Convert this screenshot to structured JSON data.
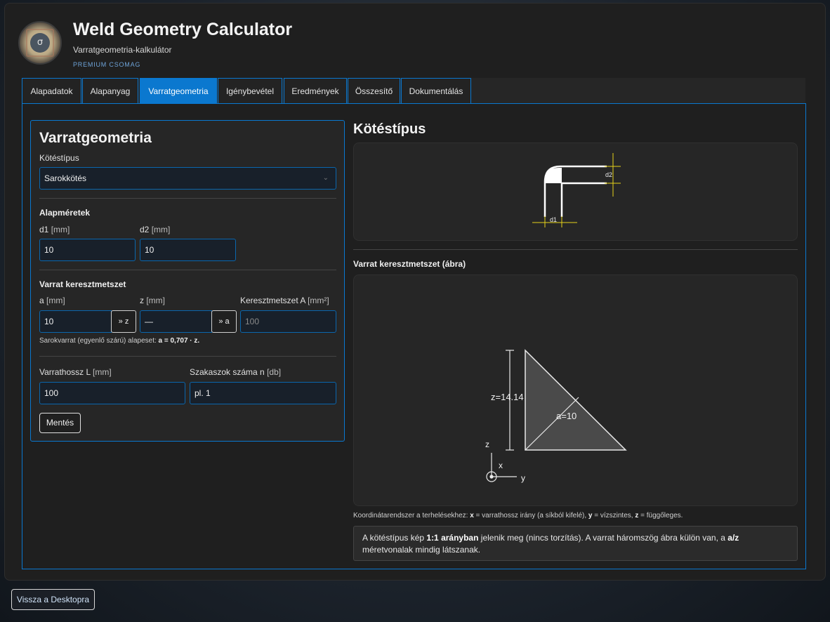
{
  "app": {
    "title": "Weld Geometry Calculator",
    "subtitle": "Varratgeometria-kalkulátor",
    "badge": "PREMIUM CSOMAG",
    "logo_glyph": "σ"
  },
  "tabs": [
    {
      "label": "Alapadatok",
      "active": false
    },
    {
      "label": "Alapanyag",
      "active": false
    },
    {
      "label": "Varratgeometria",
      "active": true
    },
    {
      "label": "Igénybevétel",
      "active": false
    },
    {
      "label": "Eredmények",
      "active": false
    },
    {
      "label": "Összesítő",
      "active": false
    },
    {
      "label": "Dokumentálás",
      "active": false
    }
  ],
  "form": {
    "title": "Varratgeometria",
    "joint_type_label": "Kötéstípus",
    "joint_type_value": "Sarokkötés",
    "base_dims_title": "Alapméretek",
    "d1_label": "d1",
    "d1_unit": "[mm]",
    "d1_value": "10",
    "d2_label": "d2",
    "d2_unit": "[mm]",
    "d2_value": "10",
    "cross_title": "Varrat keresztmetszet",
    "a_label": "a",
    "a_unit": "[mm]",
    "a_value": "10",
    "a_btn": "» z",
    "z_label": "z",
    "z_unit": "[mm]",
    "z_value": "—",
    "z_btn": "» a",
    "area_label": "Keresztmetszet A",
    "area_unit": "[mm²]",
    "area_placeholder": "100",
    "note_prefix": "Sarokvarrat (egyenlő szárú) alapeset: ",
    "note_formula": "a = 0,707 · z.",
    "length_label": "Varrathossz L",
    "length_unit": "[mm]",
    "length_value": "100",
    "segments_label": "Szakaszok száma n",
    "segments_unit": "[db]",
    "segments_placeholder": "pl. 1",
    "save_label": "Mentés"
  },
  "right": {
    "title": "Kötéstípus",
    "d1_dim": "d1",
    "d2_dim": "d2",
    "section_title": "Varrat keresztmetszet (ábra)",
    "z_text": "z=14.14",
    "a_text": "a=10",
    "axis_z": "z",
    "axis_x": "x",
    "axis_y": "y",
    "coord_prefix": "Koordinátarendszer a terhelésekhez: ",
    "coord_x": "x",
    "coord_x_desc": " = varrathossz irány (a síkból kifelé), ",
    "coord_y": "y",
    "coord_y_desc": " = vízszintes, ",
    "coord_z": "z",
    "coord_z_desc": " = függőleges.",
    "info_1": "A kötéstípus kép ",
    "info_bold1": "1:1 arányban",
    "info_2": " jelenik meg (nincs torzítás). A varrat háromszög ábra külön van, a ",
    "info_bold2": "a/z",
    "info_3": " méretvonalak mindig látszanak."
  },
  "footer": {
    "back_label": "Vissza a Desktopra"
  },
  "colors": {
    "accent": "#0b78cf",
    "dim_yellow": "#e6d21a"
  }
}
